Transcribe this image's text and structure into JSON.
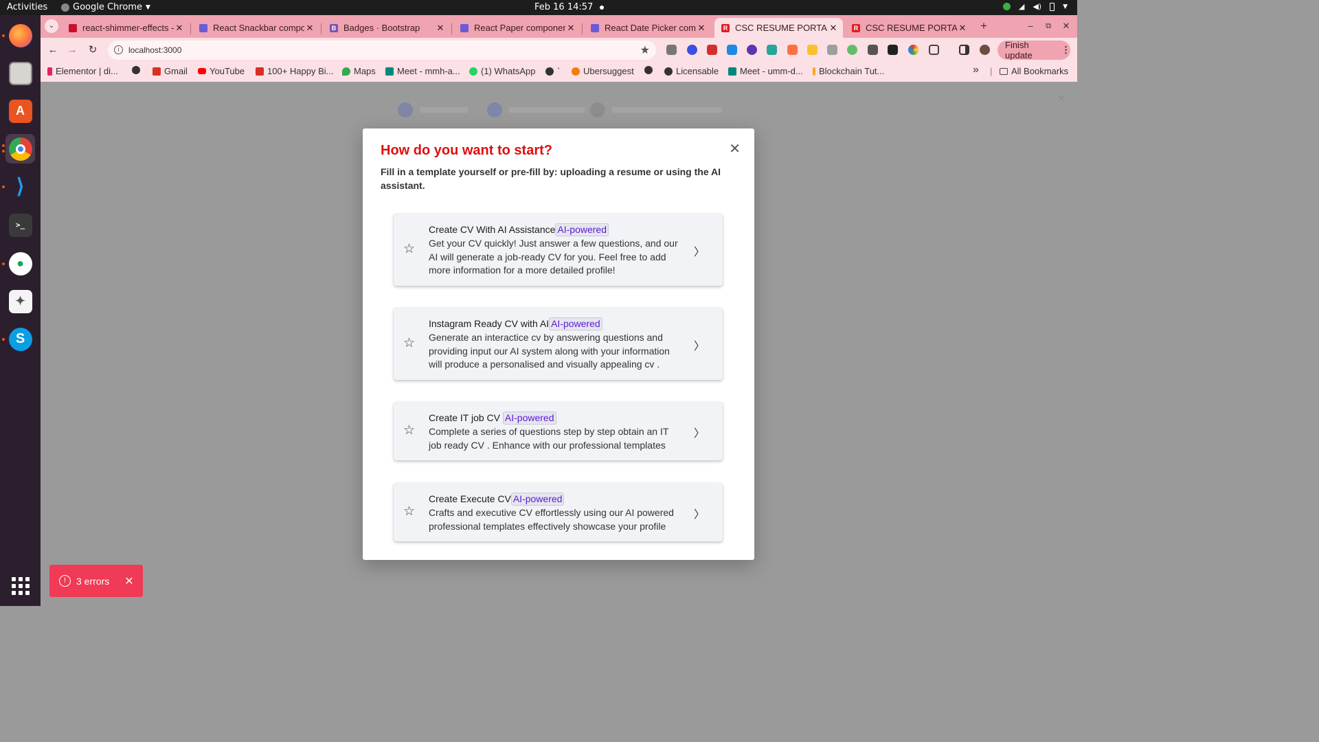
{
  "os": {
    "activities": "Activities",
    "app_name": "Google Chrome",
    "clock": "Feb 16  14:57"
  },
  "tabs": [
    {
      "title": "react-shimmer-effects -",
      "favicon_color": "#c8102e",
      "favicon_letter": ""
    },
    {
      "title": "React Snackbar compon",
      "favicon_color": "#6b5bd6",
      "favicon_letter": ""
    },
    {
      "title": "Badges · Bootstrap",
      "favicon_color": "#7952b3",
      "favicon_letter": "B"
    },
    {
      "title": "React Paper componen",
      "favicon_color": "#6b5bd6",
      "favicon_letter": ""
    },
    {
      "title": "React Date Picker comp",
      "favicon_color": "#6b5bd6",
      "favicon_letter": ""
    },
    {
      "title": "CSC RESUME PORTAL",
      "favicon_color": "#e31b23",
      "favicon_letter": "R",
      "active": true
    },
    {
      "title": "CSC RESUME PORTAL",
      "favicon_color": "#e31b23",
      "favicon_letter": "R"
    }
  ],
  "toolbar": {
    "url": "localhost:3000",
    "finish_update": "Finish update"
  },
  "bookmarks": [
    {
      "label": "Elementor | di...",
      "color": "#e0245e"
    },
    {
      "label": "",
      "color": "#333333"
    },
    {
      "label": "Gmail",
      "color": "#d93025"
    },
    {
      "label": "YouTube",
      "color": "#ff0000"
    },
    {
      "label": "100+ Happy Bi...",
      "color": "#d93025"
    },
    {
      "label": "Maps",
      "color": "#34a853"
    },
    {
      "label": "Meet - mmh-a...",
      "color": "#00897b"
    },
    {
      "label": "(1) WhatsApp",
      "color": "#25d366"
    },
    {
      "label": "`",
      "color": "#333333"
    },
    {
      "label": "Ubersuggest",
      "color": "#f57c00"
    },
    {
      "label": "",
      "color": "#333333"
    },
    {
      "label": "Licensable",
      "color": "#333333"
    },
    {
      "label": "Meet - umm-d...",
      "color": "#00897b"
    },
    {
      "label": "Blockchain Tut...",
      "color": "#f9a825"
    }
  ],
  "bookmarks_more": "»",
  "all_bookmarks": "All Bookmarks",
  "modal": {
    "title": "How do you want to start?",
    "subtitle": "Fill in a template yourself or pre-fill by: uploading a resume or using the AI assistant.",
    "options": [
      {
        "title": "Create CV With AI Assistance",
        "badge": "AI-powered",
        "description": "Get your CV quickly! Just answer a few questions, and our AI will generate a job-ready CV for you. Feel free to add more information for a more detailed profile!"
      },
      {
        "title": "Instagram Ready CV with AI",
        "badge": "AI-powered",
        "description": "Generate an interactice cv by answering questions and providing input our AI system along with your information will produce a personalised and visually appealing cv ."
      },
      {
        "title": "Create IT job CV ",
        "badge": "AI-powered",
        "description": "Complete a series of questions step by step obtain an IT job ready CV . Enhance with our professional templates"
      },
      {
        "title": "Create Execute CV",
        "badge": "AI-powered",
        "description": "Crafts and executive CV effortlessly using our AI powered professional templates effectively showcase your profile"
      }
    ]
  },
  "toast": {
    "text": "3 errors"
  },
  "colors": {
    "title_red": "#e00d0d",
    "badge_purple": "#5a1ad6",
    "toast_red": "#f03a56",
    "chrome_tabstrip": "#f0a3b0"
  }
}
